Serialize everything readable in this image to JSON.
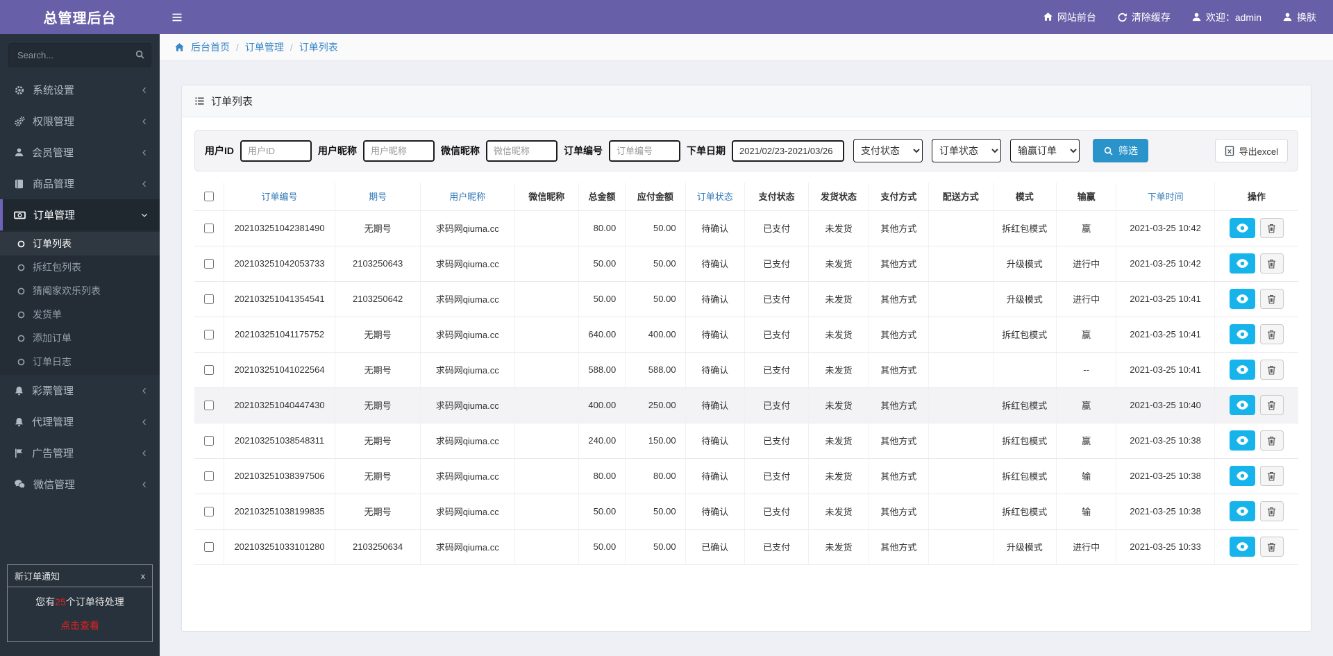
{
  "colors": {
    "topbar_purple": "#675fa7",
    "sidebar_dark": "#28323c",
    "link_blue": "#3a87c8",
    "header_link_blue": "#337ab7",
    "filter_button_blue": "#2a93c9",
    "view_button_cyan": "#17b4ec",
    "win_red": "#e02121"
  },
  "topbar": {
    "brand": "总管理后台",
    "links": [
      {
        "icon": "home",
        "label": "网站前台"
      },
      {
        "icon": "refresh",
        "label": "清除缓存"
      },
      {
        "icon": "user",
        "label": "欢迎：admin"
      },
      {
        "icon": "skin",
        "label": "换肤"
      }
    ]
  },
  "sidebar": {
    "search_placeholder": "Search...",
    "menu": [
      {
        "icon": "gear",
        "label": "系统设置",
        "active": false
      },
      {
        "icon": "gears",
        "label": "权限管理",
        "active": false
      },
      {
        "icon": "user",
        "label": "会员管理",
        "active": false
      },
      {
        "icon": "book",
        "label": "商品管理",
        "active": false
      },
      {
        "icon": "money",
        "label": "订单管理",
        "active": true,
        "children": [
          {
            "label": "订单列表",
            "active": true
          },
          {
            "label": "拆红包列表",
            "active": false
          },
          {
            "label": "猜阄家欢乐列表",
            "active": false
          },
          {
            "label": "发货单",
            "active": false
          },
          {
            "label": "添加订单",
            "active": false
          },
          {
            "label": "订单日志",
            "active": false
          }
        ]
      },
      {
        "icon": "bell",
        "label": "彩票管理",
        "active": false
      },
      {
        "icon": "bell",
        "label": "代理管理",
        "active": false
      },
      {
        "icon": "flag",
        "label": "广告管理",
        "active": false
      },
      {
        "icon": "wechat",
        "label": "微信管理",
        "active": false
      }
    ],
    "notification": {
      "title": "新订单通知",
      "close": "x",
      "message_prefix": "您有",
      "count": "25",
      "message_suffix": "个订单待处理",
      "link": "点击查看"
    }
  },
  "breadcrumb": {
    "items": [
      "后台首页",
      "订单管理",
      "订单列表"
    ],
    "separator": "/"
  },
  "panel": {
    "title": "订单列表"
  },
  "filters": {
    "fields": [
      {
        "label": "用户ID",
        "placeholder": "用户ID",
        "name": "user-id"
      },
      {
        "label": "用户昵称",
        "placeholder": "用户昵称",
        "name": "user-nickname"
      },
      {
        "label": "微信昵称",
        "placeholder": "微信昵称",
        "name": "wechat-nickname"
      },
      {
        "label": "订单编号",
        "placeholder": "订单编号",
        "name": "order-no"
      }
    ],
    "date": {
      "label": "下单日期",
      "value": "2021/02/23-2021/03/26"
    },
    "selects": [
      {
        "name": "pay-status",
        "value": "支付状态"
      },
      {
        "name": "order-status",
        "value": "订单状态"
      },
      {
        "name": "win-lose-order",
        "value": "输赢订单"
      }
    ],
    "submit_label": "筛选",
    "export_label": "导出excel"
  },
  "table": {
    "headers": [
      {
        "label": "订单编号",
        "link": true
      },
      {
        "label": "期号",
        "link": true
      },
      {
        "label": "用户昵称",
        "link": true
      },
      {
        "label": "微信昵称",
        "link": false
      },
      {
        "label": "总金额",
        "link": false
      },
      {
        "label": "应付金额",
        "link": false
      },
      {
        "label": "订单状态",
        "link": true
      },
      {
        "label": "支付状态",
        "link": false
      },
      {
        "label": "发货状态",
        "link": false
      },
      {
        "label": "支付方式",
        "link": false
      },
      {
        "label": "配送方式",
        "link": false
      },
      {
        "label": "模式",
        "link": false
      },
      {
        "label": "输赢",
        "link": false
      },
      {
        "label": "下单时间",
        "link": true
      },
      {
        "label": "操作",
        "link": false
      }
    ],
    "rows": [
      {
        "order_no": "202103251042381490",
        "period": "无期号",
        "nickname": "求码网qiuma.cc",
        "wechat": "",
        "total": "80.00",
        "payable": "50.00",
        "order_status": "待确认",
        "pay_status": "已支付",
        "ship_status": "未发货",
        "pay_method": "其他方式",
        "delivery": "",
        "mode": "拆红包模式",
        "result": "赢",
        "result_style": "win",
        "time": "2021-03-25 10:42",
        "highlight": false
      },
      {
        "order_no": "202103251042053733",
        "period": "2103250643",
        "nickname": "求码网qiuma.cc",
        "wechat": "",
        "total": "50.00",
        "payable": "50.00",
        "order_status": "待确认",
        "pay_status": "已支付",
        "ship_status": "未发货",
        "pay_method": "其他方式",
        "delivery": "",
        "mode": "升级模式",
        "result": "进行中",
        "result_style": "normal",
        "time": "2021-03-25 10:42",
        "highlight": false
      },
      {
        "order_no": "202103251041354541",
        "period": "2103250642",
        "nickname": "求码网qiuma.cc",
        "wechat": "",
        "total": "50.00",
        "payable": "50.00",
        "order_status": "待确认",
        "pay_status": "已支付",
        "ship_status": "未发货",
        "pay_method": "其他方式",
        "delivery": "",
        "mode": "升级模式",
        "result": "进行中",
        "result_style": "normal",
        "time": "2021-03-25 10:41",
        "highlight": false
      },
      {
        "order_no": "202103251041175752",
        "period": "无期号",
        "nickname": "求码网qiuma.cc",
        "wechat": "",
        "total": "640.00",
        "payable": "400.00",
        "order_status": "待确认",
        "pay_status": "已支付",
        "ship_status": "未发货",
        "pay_method": "其他方式",
        "delivery": "",
        "mode": "拆红包模式",
        "result": "赢",
        "result_style": "win",
        "time": "2021-03-25 10:41",
        "highlight": false
      },
      {
        "order_no": "202103251041022564",
        "period": "无期号",
        "nickname": "求码网qiuma.cc",
        "wechat": "",
        "total": "588.00",
        "payable": "588.00",
        "order_status": "待确认",
        "pay_status": "已支付",
        "ship_status": "未发货",
        "pay_method": "其他方式",
        "delivery": "",
        "mode": "",
        "result": "--",
        "result_style": "muted",
        "time": "2021-03-25 10:41",
        "highlight": false
      },
      {
        "order_no": "202103251040447430",
        "period": "无期号",
        "nickname": "求码网qiuma.cc",
        "wechat": "",
        "total": "400.00",
        "payable": "250.00",
        "order_status": "待确认",
        "pay_status": "已支付",
        "ship_status": "未发货",
        "pay_method": "其他方式",
        "delivery": "",
        "mode": "拆红包模式",
        "result": "赢",
        "result_style": "win",
        "time": "2021-03-25 10:40",
        "highlight": true
      },
      {
        "order_no": "202103251038548311",
        "period": "无期号",
        "nickname": "求码网qiuma.cc",
        "wechat": "",
        "total": "240.00",
        "payable": "150.00",
        "order_status": "待确认",
        "pay_status": "已支付",
        "ship_status": "未发货",
        "pay_method": "其他方式",
        "delivery": "",
        "mode": "拆红包模式",
        "result": "赢",
        "result_style": "win",
        "time": "2021-03-25 10:38",
        "highlight": false
      },
      {
        "order_no": "202103251038397506",
        "period": "无期号",
        "nickname": "求码网qiuma.cc",
        "wechat": "",
        "total": "80.00",
        "payable": "80.00",
        "order_status": "待确认",
        "pay_status": "已支付",
        "ship_status": "未发货",
        "pay_method": "其他方式",
        "delivery": "",
        "mode": "拆红包模式",
        "result": "输",
        "result_style": "normal",
        "time": "2021-03-25 10:38",
        "highlight": false
      },
      {
        "order_no": "202103251038199835",
        "period": "无期号",
        "nickname": "求码网qiuma.cc",
        "wechat": "",
        "total": "50.00",
        "payable": "50.00",
        "order_status": "待确认",
        "pay_status": "已支付",
        "ship_status": "未发货",
        "pay_method": "其他方式",
        "delivery": "",
        "mode": "拆红包模式",
        "result": "输",
        "result_style": "normal",
        "time": "2021-03-25 10:38",
        "highlight": false
      },
      {
        "order_no": "202103251033101280",
        "period": "2103250634",
        "nickname": "求码网qiuma.cc",
        "wechat": "",
        "total": "50.00",
        "payable": "50.00",
        "order_status": "已确认",
        "pay_status": "已支付",
        "ship_status": "未发货",
        "pay_method": "其他方式",
        "delivery": "",
        "mode": "升级模式",
        "result": "进行中",
        "result_style": "normal",
        "time": "2021-03-25 10:33",
        "highlight": false
      }
    ]
  }
}
